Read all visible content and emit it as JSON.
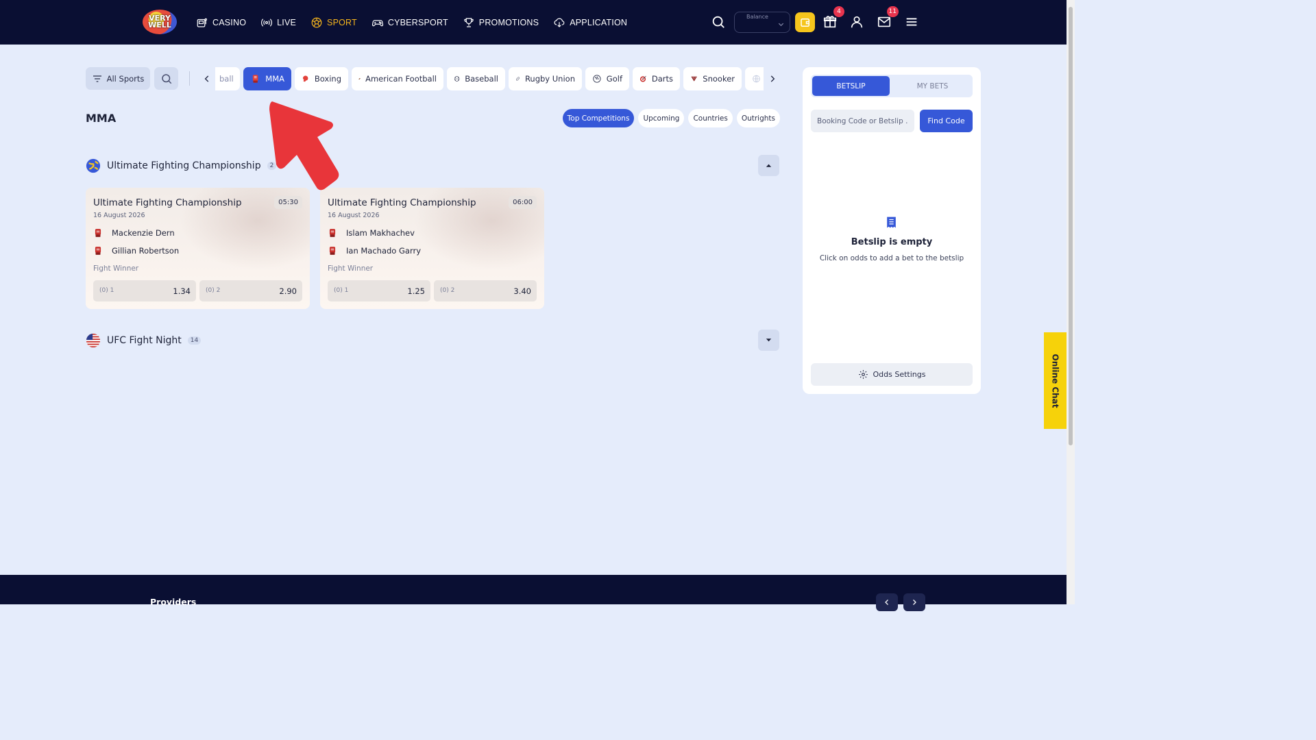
{
  "header": {
    "logo_text": "VERY WELL",
    "nav": [
      {
        "label": "CASINO",
        "icon": "slot-machine-icon"
      },
      {
        "label": "LIVE",
        "icon": "broadcast-icon"
      },
      {
        "label": "SPORT",
        "icon": "soccer-ball-icon",
        "active": true
      },
      {
        "label": "CYBERSPORT",
        "icon": "gamepad-icon"
      },
      {
        "label": "PROMOTIONS",
        "icon": "trophy-icon"
      },
      {
        "label": "APPLICATION",
        "icon": "download-cloud-icon"
      }
    ],
    "balance_label": "Balance",
    "gift_badge": "4",
    "mail_badge": "11"
  },
  "sports_bar": {
    "all_sports_label": "All Sports",
    "chips": [
      {
        "label": "ball",
        "icon": "volleyball-icon"
      },
      {
        "label": "MMA",
        "icon": "mma-glove-icon",
        "active": true
      },
      {
        "label": "Boxing",
        "icon": "boxing-glove-icon"
      },
      {
        "label": "American Football",
        "icon": "american-football-icon"
      },
      {
        "label": "Baseball",
        "icon": "baseball-icon"
      },
      {
        "label": "Rugby Union",
        "icon": "rugby-ball-icon"
      },
      {
        "label": "Golf",
        "icon": "golf-ball-icon"
      },
      {
        "label": "Darts",
        "icon": "dartboard-icon"
      },
      {
        "label": "Snooker",
        "icon": "snooker-icon"
      },
      {
        "label": "",
        "icon": "globe-icon"
      }
    ]
  },
  "page_title": "MMA",
  "tabs": [
    {
      "label": "Top Competitions",
      "active": true
    },
    {
      "label": "Upcoming"
    },
    {
      "label": "Countries"
    },
    {
      "label": "Outrights"
    }
  ],
  "competitions": [
    {
      "name": "Ultimate Fighting Championship",
      "count": "2",
      "flag": "world-flag-icon",
      "expanded": true,
      "matches": [
        {
          "title": "Ultimate Fighting Championship",
          "time": "05:30",
          "date": "16 August 2026",
          "fighters": [
            "Mackenzie Dern",
            "Gillian Robertson"
          ],
          "market": "Fight Winner",
          "odds": [
            {
              "label": "(0) 1",
              "value": "1.34"
            },
            {
              "label": "(0) 2",
              "value": "2.90"
            }
          ]
        },
        {
          "title": "Ultimate Fighting Championship",
          "time": "06:00",
          "date": "16 August 2026",
          "fighters": [
            "Islam Makhachev",
            "Ian Machado Garry"
          ],
          "market": "Fight Winner",
          "odds": [
            {
              "label": "(0) 1",
              "value": "1.25"
            },
            {
              "label": "(0) 2",
              "value": "3.40"
            }
          ]
        }
      ]
    },
    {
      "name": "UFC Fight Night",
      "count": "14",
      "flag": "usa-flag-icon",
      "expanded": false
    }
  ],
  "betslip": {
    "tab_betslip": "BETSLIP",
    "tab_my_bets": "MY BETS",
    "code_placeholder": "Booking Code or Betslip ...",
    "find_button": "Find Code",
    "empty_title": "Betslip is empty",
    "empty_subtitle": "Click on odds to add a bet to the betslip",
    "odds_settings": "Odds Settings"
  },
  "online_chat": "Online Chat",
  "footer": {
    "providers_label": "Providers"
  },
  "colors": {
    "header_bg": "#0a0f33",
    "accent_blue": "#3658d8",
    "sport_active": "#f6b51c",
    "wallet_yellow": "#f6c51c",
    "page_bg": "#e5ecfb",
    "badge_red": "#e8344e",
    "arrow_red": "#e8353a"
  }
}
